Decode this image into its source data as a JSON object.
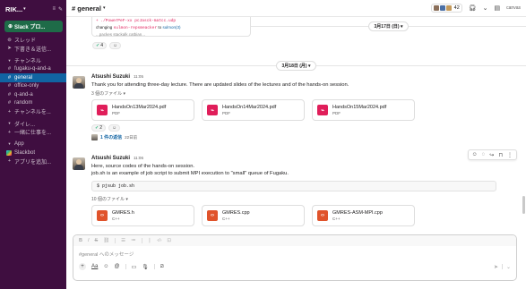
{
  "sidebar": {
    "workspace_name": "RIK...",
    "pro_button": "Slack プロ...",
    "items": [
      {
        "icon": "thread-icon",
        "glyph": "⊚",
        "label": "スレッド"
      },
      {
        "icon": "draft-icon",
        "glyph": "➤",
        "label": "下書き＆送信..."
      }
    ],
    "channels_section": "チャンネル",
    "channels": [
      {
        "label": "fugaku-q-and-a",
        "active": false
      },
      {
        "label": "general",
        "active": true
      },
      {
        "label": "office-only",
        "active": false
      },
      {
        "label": "q-and-a",
        "active": false
      },
      {
        "label": "random",
        "active": false
      }
    ],
    "add_channel": "チャンネルを...",
    "dm_section": "ダイレ...",
    "dm_invite": "一緒に仕事を...",
    "apps_section": "App",
    "slackbot": "Slackbot",
    "add_app": "アプリを追加..."
  },
  "header": {
    "channel": "# general",
    "member_count": "42",
    "canvas_label": "canvas"
  },
  "prev_message": {
    "code_line": "+ ./PowerPeF-xx pcJasck-matcc.udp",
    "text_prefix": "changing",
    "text_code": "sulmon-repsmeacker",
    "text_mid": "to",
    "text_link": "sulmon(3)",
    "tail": "...packes stackalk.catbian..."
  },
  "reactions_top": [
    {
      "emoji": "✅",
      "count": "4"
    }
  ],
  "date_dividers": {
    "first": "3月17日 (日)",
    "second": "3月18日 (月)"
  },
  "message1": {
    "author": "Atsushi Suzuki",
    "time": "11:05",
    "text": "Thank you for attending three-day lecture. There are updated slides of the lectures and of the hands-on session.",
    "files_label": "3 個のファイル",
    "files": [
      {
        "name": "HandsOn13Mar2024.pdf",
        "type": "PDF"
      },
      {
        "name": "HandsOn14Mar2024.pdf",
        "type": "PDF"
      },
      {
        "name": "HandsOn15Mar2024.pdf",
        "type": "PDF"
      }
    ],
    "reactions": [
      {
        "emoji": "✅",
        "count": "2"
      }
    ],
    "thread_reply": "1 件の返信",
    "thread_time": "22日前"
  },
  "message2": {
    "author": "Atsushi Suzuki",
    "time": "11:06",
    "text_line1": "Here, source codes of the hands-on session.",
    "text_line2": "job.sh is an example of job script to submit MPI execution to \"small\" queue of Fugaku.",
    "code": "$ pjsub job.sh",
    "files_label": "10 個のファイル",
    "files": [
      {
        "name": "GMRES.h",
        "type": "C++"
      },
      {
        "name": "GMRES.cpp",
        "type": "C++"
      },
      {
        "name": "GMRES-ASM-MPI.cpp",
        "type": "C++"
      }
    ]
  },
  "composer": {
    "placeholder": "#general へのメッセージ"
  }
}
